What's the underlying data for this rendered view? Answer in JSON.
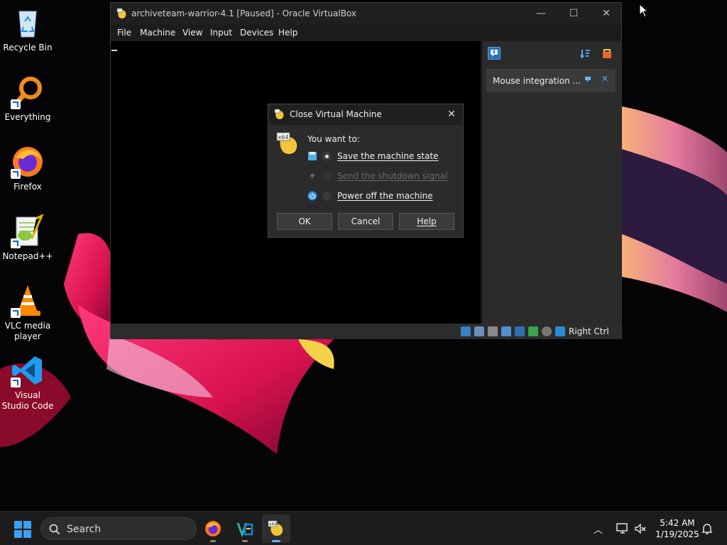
{
  "desktop": {
    "icons": [
      {
        "label": "Recycle Bin"
      },
      {
        "label": "Everything"
      },
      {
        "label": "Firefox"
      },
      {
        "label": "Notepad++"
      },
      {
        "label": "VLC media player"
      },
      {
        "label": "Visual Studio Code"
      }
    ]
  },
  "vbox": {
    "title": "archiveteam-warrior-4.1 [Paused] - Oracle VirtualBox",
    "menu": [
      "File",
      "Machine",
      "View",
      "Input",
      "Devices",
      "Help"
    ],
    "notice": "Mouse integration ...",
    "host_key": "Right Ctrl"
  },
  "dialog": {
    "title": "Close Virtual Machine",
    "prompt": "You want to:",
    "options": [
      {
        "label": "Save the machine state",
        "checked": true,
        "enabled": true
      },
      {
        "label": "Send the shutdown signal",
        "checked": false,
        "enabled": false
      },
      {
        "label": "Power off the machine",
        "checked": false,
        "enabled": true
      }
    ],
    "buttons": {
      "ok": "OK",
      "cancel": "Cancel",
      "help": "Help"
    }
  },
  "taskbar": {
    "search_label": "Search",
    "time": "5:42 AM",
    "date": "1/19/2025"
  },
  "colors": {
    "accent": "#5fb2f2",
    "window_bg": "#202020",
    "dialog_bg": "#2b2b2b"
  }
}
